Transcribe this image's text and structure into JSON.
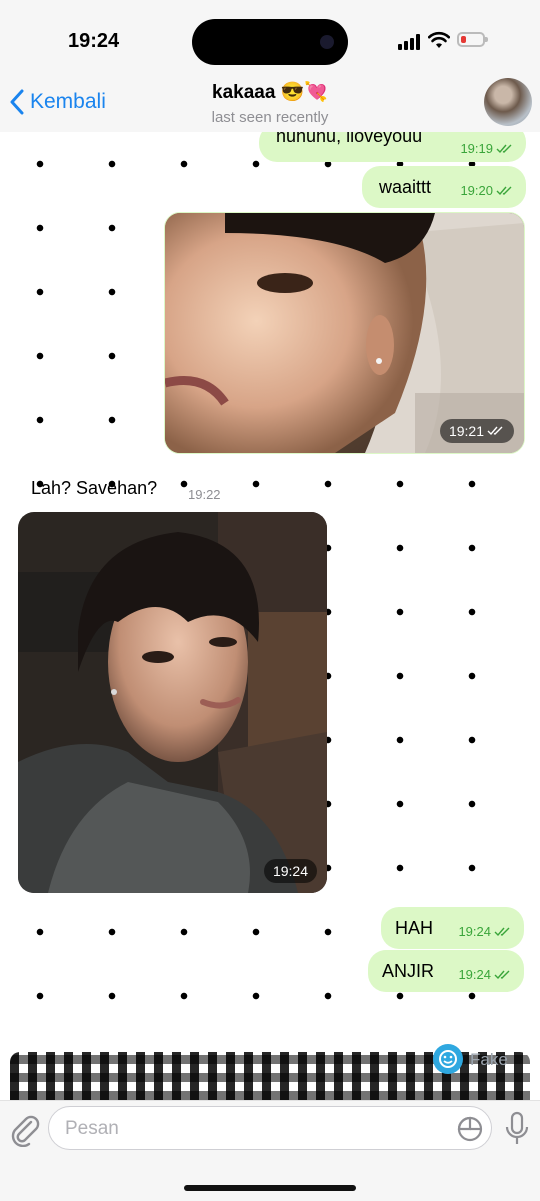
{
  "status_bar": {
    "time": "19:24"
  },
  "header": {
    "back_label": "Kembali",
    "contact_name": "kakaaa 😎💘",
    "last_seen": "last seen recently"
  },
  "messages": [
    {
      "type": "text",
      "direction": "outgoing",
      "text": "huhuhu, iloveyouu",
      "time": "19:19",
      "read": true
    },
    {
      "type": "text",
      "direction": "outgoing",
      "text": "waaittt",
      "time": "19:20",
      "read": true
    },
    {
      "type": "photo",
      "direction": "outgoing",
      "time": "19:21",
      "read": true
    },
    {
      "type": "text",
      "direction": "incoming",
      "text": "Lah? Savehan?",
      "time": "19:22"
    },
    {
      "type": "photo",
      "direction": "incoming",
      "time": "19:24"
    },
    {
      "type": "text",
      "direction": "outgoing",
      "text": "HAH",
      "time": "19:24",
      "read": true
    },
    {
      "type": "text",
      "direction": "outgoing",
      "text": "ANJIR",
      "time": "19:24",
      "read": true
    }
  ],
  "watermark": {
    "label": "Fake"
  },
  "composer": {
    "placeholder": "Pesan"
  },
  "colors": {
    "accent": "#1a84ee",
    "outgoing_bubble": "#dcf8c6",
    "read_ticks": "#3aa53a"
  }
}
